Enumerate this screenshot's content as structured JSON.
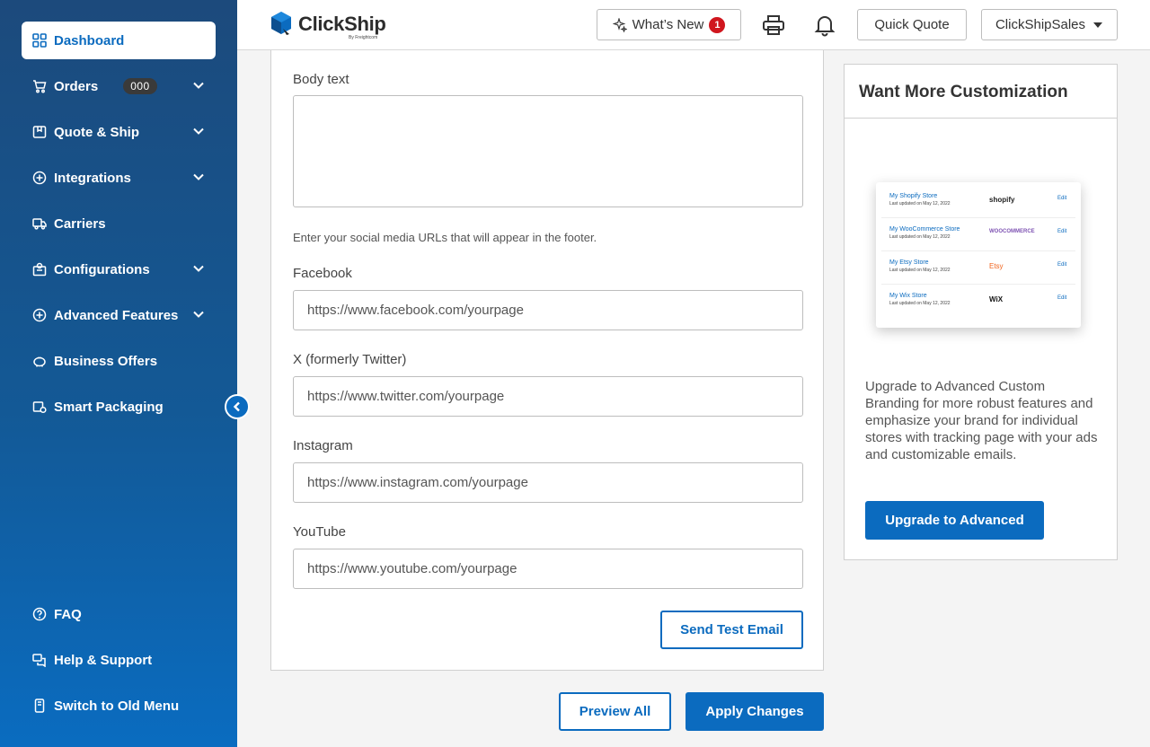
{
  "sidebar": {
    "items": [
      {
        "label": "Dashboard",
        "icon": "grid-icon",
        "active": true
      },
      {
        "label": "Orders",
        "icon": "cart-icon",
        "badge": "000",
        "expandable": true
      },
      {
        "label": "Quote & Ship",
        "icon": "package-icon",
        "expandable": true
      },
      {
        "label": "Integrations",
        "icon": "plus-circle-icon",
        "expandable": true
      },
      {
        "label": "Carriers",
        "icon": "truck-icon"
      },
      {
        "label": "Configurations",
        "icon": "gear-box-icon",
        "expandable": true
      },
      {
        "label": "Advanced Features",
        "icon": "plus-circle-icon",
        "expandable": true
      },
      {
        "label": "Business Offers",
        "icon": "piggy-bank-icon"
      },
      {
        "label": "Smart Packaging",
        "icon": "box-gear-icon"
      }
    ],
    "bottom_items": [
      {
        "label": "FAQ",
        "icon": "question-circle-icon"
      },
      {
        "label": "Help & Support",
        "icon": "chat-support-icon"
      },
      {
        "label": "Switch to Old Menu",
        "icon": "phone-switch-icon"
      }
    ]
  },
  "topbar": {
    "logo_text": "ClickShip",
    "logo_sub": "By Freightcom",
    "whats_new": "What’s New",
    "whats_new_count": "1",
    "quick_quote": "Quick Quote",
    "account": "ClickShipSales"
  },
  "form": {
    "body_text_label": "Body text",
    "social_hint": "Enter your social media URLs that will appear in the footer.",
    "facebook_label": "Facebook",
    "facebook_placeholder": "https://www.facebook.com/yourpage",
    "twitter_label": "X (formerly Twitter)",
    "twitter_placeholder": "https://www.twitter.com/yourpage",
    "instagram_label": "Instagram",
    "instagram_placeholder": "https://www.instagram.com/yourpage",
    "youtube_label": "YouTube",
    "youtube_placeholder": "https://www.youtube.com/yourpage",
    "send_test": "Send Test Email"
  },
  "actions": {
    "preview_all": "Preview All",
    "apply_changes": "Apply Changes"
  },
  "promo": {
    "title": "Want More Customization",
    "stores": [
      {
        "name": "My Shopify Store",
        "date": "Last updated on May 12, 2022",
        "logo": "shopify",
        "edit": "Edit"
      },
      {
        "name": "My WooCommerce Store",
        "date": "Last updated on May 12, 2022",
        "logo": "WOOCOMMERCE",
        "edit": "Edit"
      },
      {
        "name": "My Etsy Store",
        "date": "Last updated on May 12, 2022",
        "logo": "Etsy",
        "edit": "Edit"
      },
      {
        "name": "My Wix Store",
        "date": "Last updated on May 12, 2022",
        "logo": "WiX",
        "edit": "Edit"
      }
    ],
    "text": "Upgrade to Advanced Custom Branding for more robust features and  emphasize your brand for individual stores with tracking page with your  ads and customizable emails.",
    "cta": "Upgrade to Advanced"
  },
  "colors": {
    "primary": "#0b6bbf",
    "sidebar_top": "#1c4a7c",
    "sidebar_bottom": "#0a6cc0",
    "badge_red": "#d0161e"
  }
}
